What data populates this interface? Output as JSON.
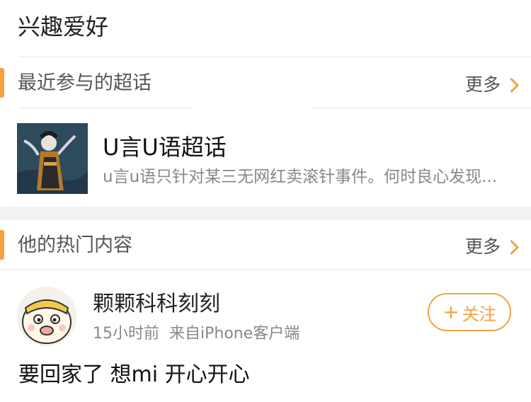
{
  "profile": {
    "section_label": "兴趣爱好"
  },
  "super_topics": {
    "title": "最近参与的超话",
    "more_label": "更多",
    "items": [
      {
        "name": "U言U语超话",
        "description": "u言u语只针对某三无网红卖滚针事件。何时良心发现..."
      }
    ]
  },
  "hot_content": {
    "title": "他的热门内容",
    "more_label": "更多",
    "post": {
      "username": "颗颗科科刻刻",
      "time": "15小时前",
      "source": "来自iPhone客户端",
      "follow_label": "关注",
      "follow_icon": "plus-icon",
      "text": "要回家了 想mi 开心开心"
    }
  },
  "colors": {
    "accent": "#f5a13d",
    "divider": "#e6e6e6",
    "band": "#f2f2f2"
  }
}
